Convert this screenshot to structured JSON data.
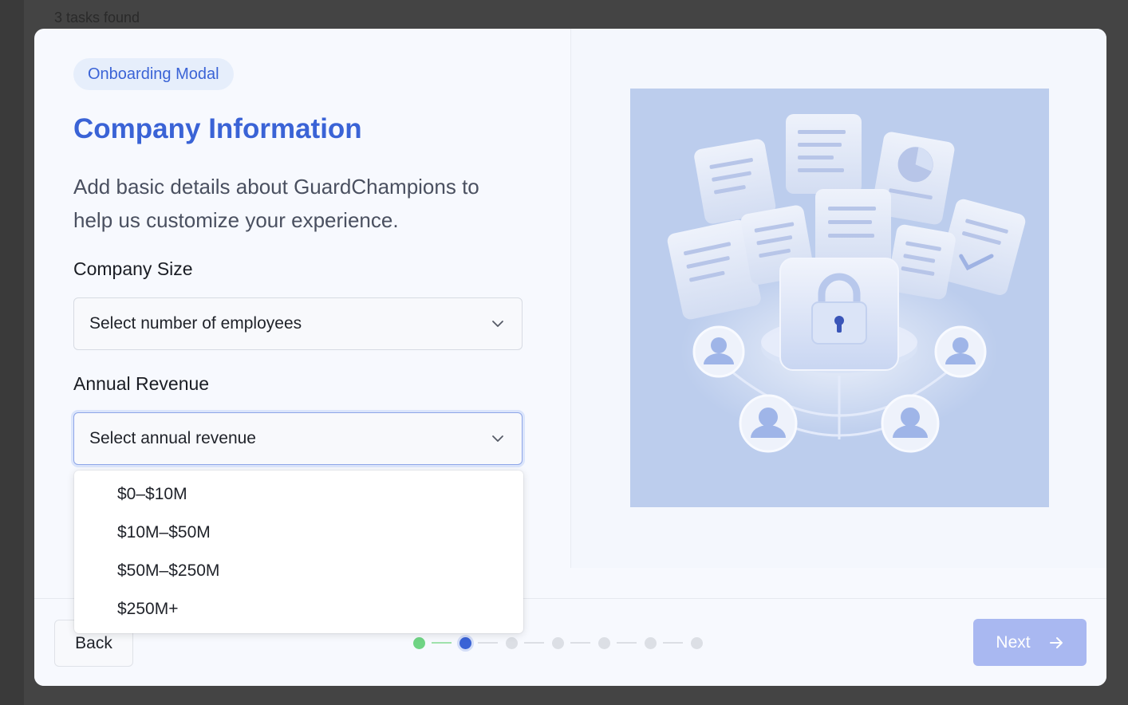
{
  "background": {
    "tasks_found": "3 tasks found"
  },
  "modal": {
    "badge": "Onboarding Modal",
    "title": "Company Information",
    "subtitle": "Add basic details about GuardChampions to help us customize your experience.",
    "company_size": {
      "label": "Company Size",
      "placeholder": "Select number of employees"
    },
    "annual_revenue": {
      "label": "Annual Revenue",
      "placeholder": "Select annual revenue",
      "options": [
        "$0–$10M",
        "$10M–$50M",
        "$50M–$250M",
        "$250M+"
      ]
    },
    "footer": {
      "back_label": "Back",
      "next_label": "Next",
      "steps_total": 7,
      "current_step": 2
    }
  },
  "colors": {
    "accent": "#3a63d6",
    "step_done": "#6fd484",
    "next_disabled": "#a9b8f1"
  },
  "icons": {
    "select_chevron": "chevron-down-icon",
    "next_arrow": "arrow-right-icon",
    "illustration": "document-security-illustration"
  }
}
